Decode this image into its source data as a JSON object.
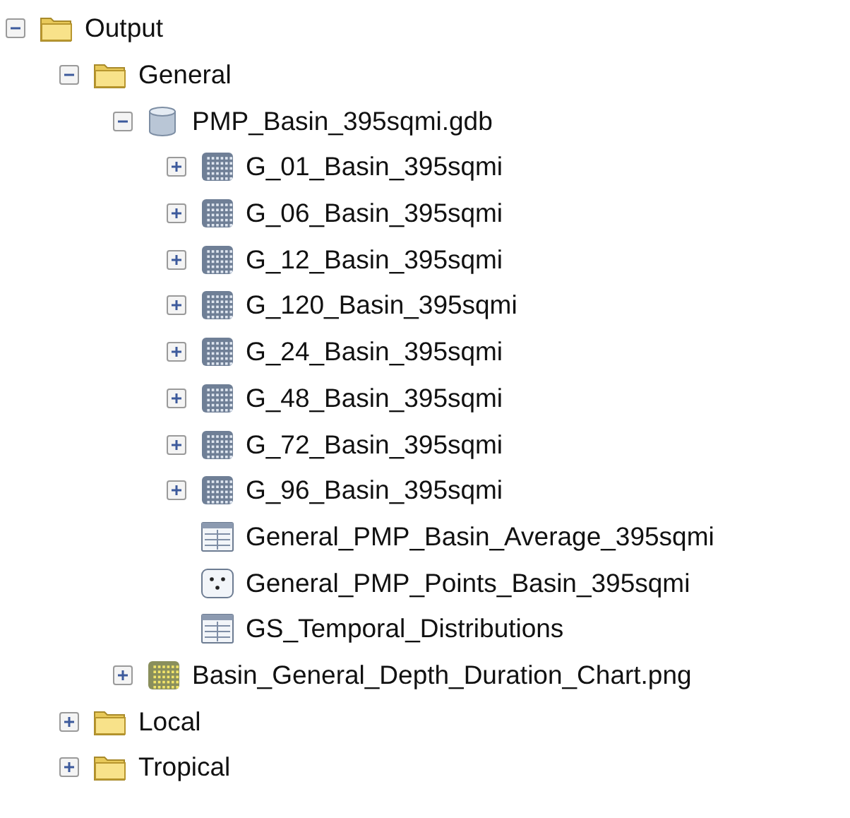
{
  "tree": [
    {
      "label": "Output",
      "kind": "folder",
      "expanded": true,
      "children": [
        {
          "label": "General",
          "kind": "folder",
          "expanded": true,
          "children": [
            {
              "label": "PMP_Basin_395sqmi.gdb",
              "kind": "database",
              "expanded": true,
              "children": [
                {
                  "label": "G_01_Basin_395sqmi",
                  "kind": "raster",
                  "expanded": false
                },
                {
                  "label": "G_06_Basin_395sqmi",
                  "kind": "raster",
                  "expanded": false
                },
                {
                  "label": "G_12_Basin_395sqmi",
                  "kind": "raster",
                  "expanded": false
                },
                {
                  "label": "G_120_Basin_395sqmi",
                  "kind": "raster",
                  "expanded": false
                },
                {
                  "label": "G_24_Basin_395sqmi",
                  "kind": "raster",
                  "expanded": false
                },
                {
                  "label": "G_48_Basin_395sqmi",
                  "kind": "raster",
                  "expanded": false
                },
                {
                  "label": "G_72_Basin_395sqmi",
                  "kind": "raster",
                  "expanded": false
                },
                {
                  "label": "G_96_Basin_395sqmi",
                  "kind": "raster",
                  "expanded": false
                },
                {
                  "label": "General_PMP_Basin_Average_395sqmi",
                  "kind": "table"
                },
                {
                  "label": "General_PMP_Points_Basin_395sqmi",
                  "kind": "points"
                },
                {
                  "label": "GS_Temporal_Distributions",
                  "kind": "table"
                }
              ]
            },
            {
              "label": "Basin_General_Depth_Duration_Chart.png",
              "kind": "image",
              "expanded": false
            }
          ]
        },
        {
          "label": "Local",
          "kind": "folder",
          "expanded": false
        },
        {
          "label": "Tropical",
          "kind": "folder",
          "expanded": false
        }
      ]
    }
  ]
}
